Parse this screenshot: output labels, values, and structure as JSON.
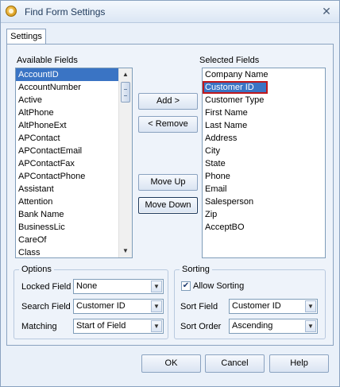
{
  "window": {
    "title": "Find Form Settings",
    "close_glyph": "✕"
  },
  "tabs": [
    {
      "label": "Settings"
    }
  ],
  "available": {
    "label": "Available Fields",
    "items": [
      "AccountID",
      "AccountNumber",
      "Active",
      "AltPhone",
      "AltPhoneExt",
      "APContact",
      "APContactEmail",
      "APContactFax",
      "APContactPhone",
      "Assistant",
      "Attention",
      "Bank Name",
      "BusinessLic",
      "CareOf",
      "Class"
    ],
    "selected_index": 0
  },
  "selected": {
    "label": "Selected Fields",
    "items": [
      "Company Name",
      "Customer ID",
      "Customer Type",
      "First Name",
      "Last Name",
      "Address",
      "City",
      "State",
      "Phone",
      "Email",
      "Salesperson",
      "Zip",
      "AcceptBO"
    ],
    "selected_index": 1
  },
  "buttons": {
    "add": "Add >",
    "remove": "< Remove",
    "move_up": "Move Up",
    "move_down": "Move Down",
    "ok": "OK",
    "cancel": "Cancel",
    "help": "Help"
  },
  "options": {
    "title": "Options",
    "locked_field_label": "Locked Field",
    "locked_field_value": "None",
    "search_field_label": "Search Field",
    "search_field_value": "Customer ID",
    "matching_label": "Matching",
    "matching_value": "Start of Field"
  },
  "sorting": {
    "title": "Sorting",
    "allow_sorting_label": "Allow Sorting",
    "allow_sorting_checked": true,
    "check_glyph": "✔",
    "sort_field_label": "Sort Field",
    "sort_field_value": "Customer ID",
    "sort_order_label": "Sort Order",
    "sort_order_value": "Ascending"
  },
  "glyphs": {
    "down_arrow": "▼",
    "up_arrow": "▲"
  },
  "colors": {
    "selection": "#3a74c4",
    "highlight_outline": "#c0181c",
    "window_bg": "#e9f0f9"
  }
}
